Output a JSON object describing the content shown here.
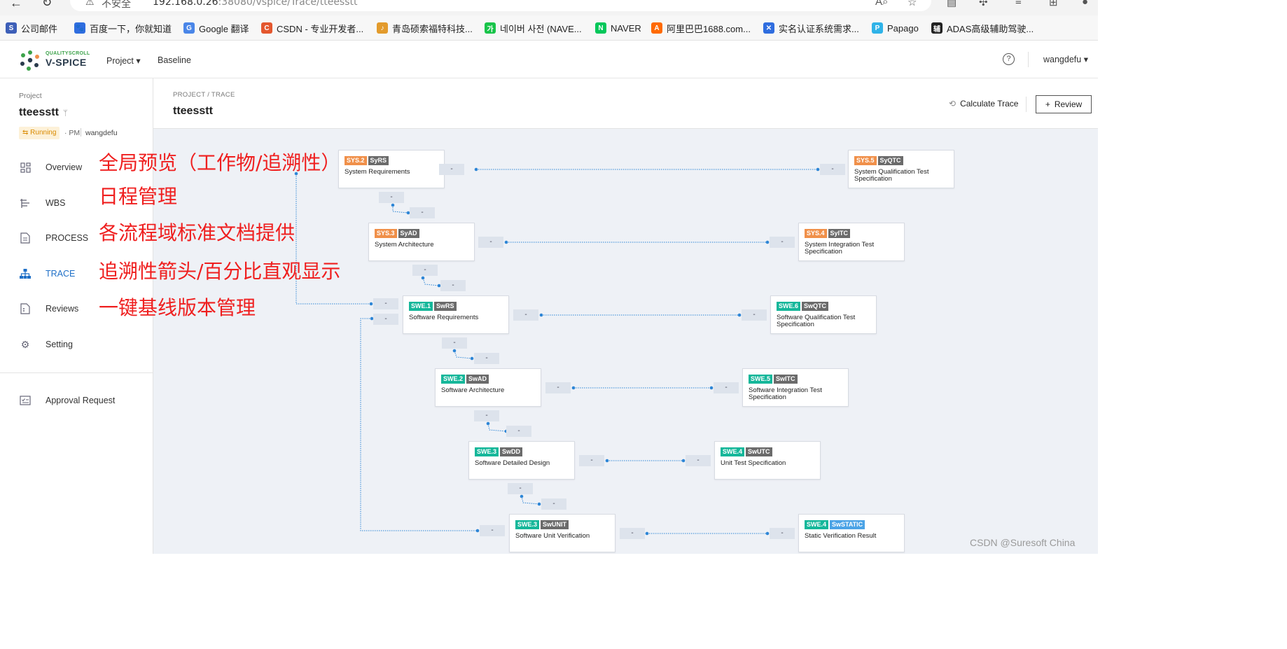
{
  "browser": {
    "warning_text": "不安全",
    "url_host": "192.168.0.26",
    "url_rest": ":38080/vspice/Trace/tteesstt"
  },
  "bookmarks": [
    {
      "label": "公司邮件",
      "color": "#3d5fb8"
    },
    {
      "label": "百度一下，你就知道",
      "color": "#2f6ddf"
    },
    {
      "label": "Google 翻译",
      "color": "#4a86e8"
    },
    {
      "label": "CSDN - 专业开发者...",
      "color": "#e4572e"
    },
    {
      "label": "青岛硕索福特科技...",
      "color": "#e39b2c"
    },
    {
      "label": "네이버 사전 (NAVE...",
      "color": "#19c44a"
    },
    {
      "label": "NAVER",
      "color": "#03c75a"
    },
    {
      "label": "阿里巴巴1688.com...",
      "color": "#ff6a00"
    },
    {
      "label": "实名认证系统需求...",
      "color": "#2f6ddf"
    },
    {
      "label": "Papago",
      "color": "#2fb3e8"
    },
    {
      "label": "ADAS高级辅助驾驶...",
      "color": "#222222"
    }
  ],
  "header": {
    "brand_small": "QUALITYSCROLL",
    "brand": "V-SPICE",
    "nav": [
      {
        "label": "Project"
      },
      {
        "label": "Baseline"
      }
    ],
    "help": "?",
    "user": "wangdefu"
  },
  "sidebar": {
    "project_label": "Project",
    "project_name": "tteesstt",
    "status": "Running",
    "role": "· PM",
    "owner": "wangdefu",
    "items": [
      {
        "label": "Overview",
        "icon": "overview-icon"
      },
      {
        "label": "WBS",
        "icon": "wbs-icon"
      },
      {
        "label": "PROCESS",
        "icon": "process-icon"
      },
      {
        "label": "TRACE",
        "icon": "trace-icon"
      },
      {
        "label": "Reviews",
        "icon": "reviews-icon"
      },
      {
        "label": "Setting",
        "icon": "setting-icon"
      },
      {
        "label": "Approval Request",
        "icon": "approval-icon"
      }
    ]
  },
  "main": {
    "breadcrumb": "PROJECT / TRACE",
    "title": "tteesstt",
    "calc_label": "Calculate Trace",
    "review_label": "Review"
  },
  "nodes": [
    {
      "id": "SYS.2",
      "abbr": "SyRS",
      "label": "System Requirements",
      "kind": "sys"
    },
    {
      "id": "SYS.5",
      "abbr": "SyQTC",
      "label": "System Qualification Test Specification",
      "kind": "sys"
    },
    {
      "id": "SYS.3",
      "abbr": "SyAD",
      "label": "System Architecture",
      "kind": "sys"
    },
    {
      "id": "SYS.4",
      "abbr": "SyITC",
      "label": "System Integration Test Specification",
      "kind": "sys"
    },
    {
      "id": "SWE.1",
      "abbr": "SwRS",
      "label": "Software Requirements",
      "kind": "swe"
    },
    {
      "id": "SWE.6",
      "abbr": "SwQTC",
      "label": "Software Qualification Test Specification",
      "kind": "swe"
    },
    {
      "id": "SWE.2",
      "abbr": "SwAD",
      "label": "Software Architecture",
      "kind": "swe"
    },
    {
      "id": "SWE.5",
      "abbr": "SwITC",
      "label": "Software Integration Test Specification",
      "kind": "swe"
    },
    {
      "id": "SWE.3",
      "abbr": "SwDD",
      "label": "Software Detailed Design",
      "kind": "swe"
    },
    {
      "id": "SWE.4",
      "abbr": "SwUTC",
      "label": "Unit Test Specification",
      "kind": "swe"
    },
    {
      "id": "SWE.3",
      "abbr": "SwUNIT",
      "label": "Software Unit Verification",
      "kind": "swe"
    },
    {
      "id": "SWE.4",
      "abbr": "SwSTATIC",
      "label": "Static Verification Result",
      "kind": "swe",
      "abbr_style": "blue"
    }
  ],
  "trace_value": "-",
  "annotations": [
    "全局预览（工作物/追溯性）",
    "日程管理",
    "各流程域标准文档提供",
    "追溯性箭头/百分比直观显示",
    "一键基线版本管理"
  ],
  "watermark": "CSDN @Suresoft China",
  "colors": {
    "accent": "#1e6fc7",
    "sys_tag": "#f0904a",
    "swe_tag": "#16b79a",
    "annotation": "#ef1f1f",
    "connector": "#2e86d6"
  }
}
